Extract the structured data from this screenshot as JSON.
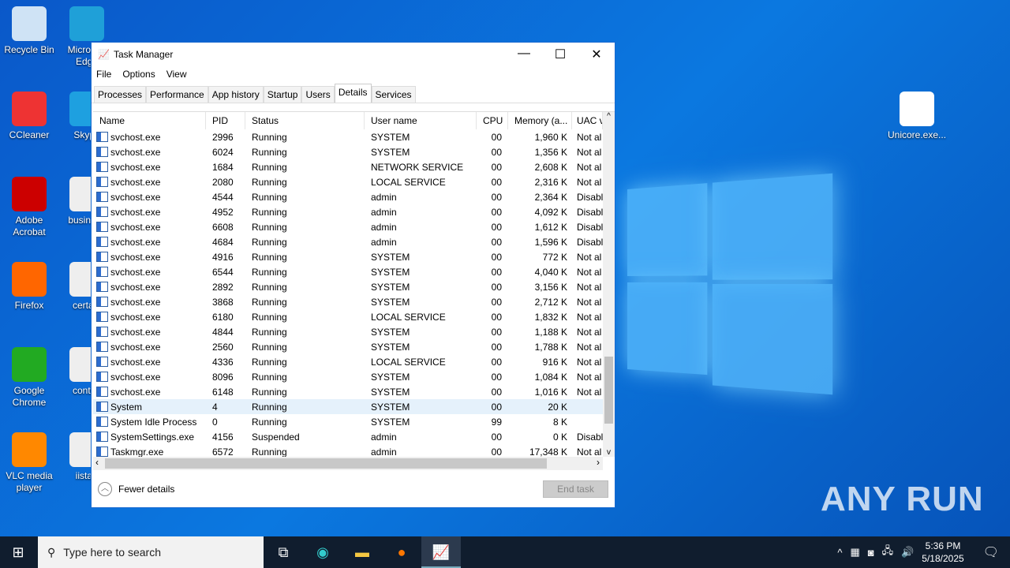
{
  "desktop": {
    "icons": [
      "Recycle Bin",
      "Microsoft Edge",
      "CCleaner",
      "Skype",
      "Adobe Acrobat",
      "business",
      "Firefox",
      "certain",
      "Google Chrome",
      "control",
      "VLC media player",
      "iistart",
      "Unicore.exe..."
    ]
  },
  "window": {
    "title": "Task Manager",
    "menu": [
      "File",
      "Options",
      "View"
    ],
    "tabs": [
      "Processes",
      "Performance",
      "App history",
      "Startup",
      "Users",
      "Details",
      "Services"
    ],
    "active_tab": "Details",
    "columns": [
      "Name",
      "PID",
      "Status",
      "User name",
      "CPU",
      "Memory (a...",
      "UAC v"
    ],
    "rows": [
      [
        "svchost.exe",
        "2996",
        "Running",
        "SYSTEM",
        "00",
        "1,960 K",
        "Not al"
      ],
      [
        "svchost.exe",
        "6024",
        "Running",
        "SYSTEM",
        "00",
        "1,356 K",
        "Not al"
      ],
      [
        "svchost.exe",
        "1684",
        "Running",
        "NETWORK SERVICE",
        "00",
        "2,608 K",
        "Not al"
      ],
      [
        "svchost.exe",
        "2080",
        "Running",
        "LOCAL SERVICE",
        "00",
        "2,316 K",
        "Not al"
      ],
      [
        "svchost.exe",
        "4544",
        "Running",
        "admin",
        "00",
        "2,364 K",
        "Disabl"
      ],
      [
        "svchost.exe",
        "4952",
        "Running",
        "admin",
        "00",
        "4,092 K",
        "Disabl"
      ],
      [
        "svchost.exe",
        "6608",
        "Running",
        "admin",
        "00",
        "1,612 K",
        "Disabl"
      ],
      [
        "svchost.exe",
        "4684",
        "Running",
        "admin",
        "00",
        "1,596 K",
        "Disabl"
      ],
      [
        "svchost.exe",
        "4916",
        "Running",
        "SYSTEM",
        "00",
        "772 K",
        "Not al"
      ],
      [
        "svchost.exe",
        "6544",
        "Running",
        "SYSTEM",
        "00",
        "4,040 K",
        "Not al"
      ],
      [
        "svchost.exe",
        "2892",
        "Running",
        "SYSTEM",
        "00",
        "3,156 K",
        "Not al"
      ],
      [
        "svchost.exe",
        "3868",
        "Running",
        "SYSTEM",
        "00",
        "2,712 K",
        "Not al"
      ],
      [
        "svchost.exe",
        "6180",
        "Running",
        "LOCAL SERVICE",
        "00",
        "1,832 K",
        "Not al"
      ],
      [
        "svchost.exe",
        "4844",
        "Running",
        "SYSTEM",
        "00",
        "1,188 K",
        "Not al"
      ],
      [
        "svchost.exe",
        "2560",
        "Running",
        "SYSTEM",
        "00",
        "1,788 K",
        "Not al"
      ],
      [
        "svchost.exe",
        "4336",
        "Running",
        "LOCAL SERVICE",
        "00",
        "916 K",
        "Not al"
      ],
      [
        "svchost.exe",
        "8096",
        "Running",
        "SYSTEM",
        "00",
        "1,084 K",
        "Not al"
      ],
      [
        "svchost.exe",
        "6148",
        "Running",
        "SYSTEM",
        "00",
        "1,016 K",
        "Not al"
      ],
      [
        "System",
        "4",
        "Running",
        "SYSTEM",
        "00",
        "20 K",
        ""
      ],
      [
        "System Idle Process",
        "0",
        "Running",
        "SYSTEM",
        "99",
        "8 K",
        ""
      ],
      [
        "SystemSettings.exe",
        "4156",
        "Suspended",
        "admin",
        "00",
        "0 K",
        "Disabl"
      ],
      [
        "Taskmgr.exe",
        "6572",
        "Running",
        "admin",
        "00",
        "17,348 K",
        "Not al"
      ]
    ],
    "selected_row": 18,
    "fewer_details": "Fewer details",
    "end_task": "End task"
  },
  "taskbar": {
    "search_placeholder": "Type here to search",
    "time": "5:36 PM",
    "date": "5/18/2025"
  },
  "watermark": "ANY RUN"
}
